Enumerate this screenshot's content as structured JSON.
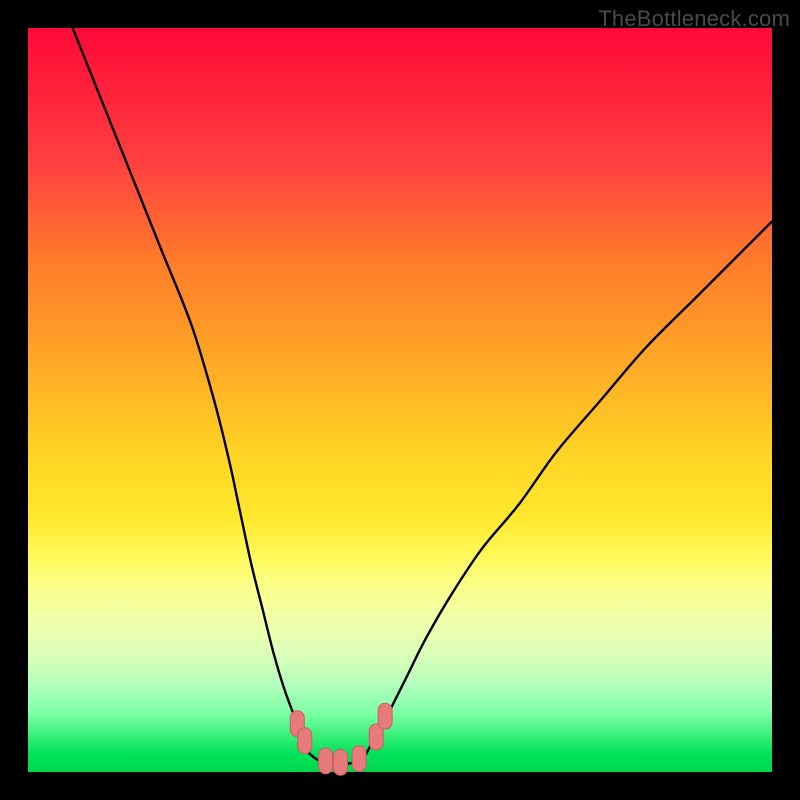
{
  "watermark": {
    "text": "TheBottleneck.com"
  },
  "colors": {
    "frame": "#000000",
    "curve": "#000000",
    "marker_fill": "#e77a7a",
    "marker_stroke": "#c76262",
    "gradient_stops": [
      "#ff0a3a",
      "#ff1a3a",
      "#ff4040",
      "#ff7a2b",
      "#ffa526",
      "#ffd324",
      "#ffe92e",
      "#fff95a",
      "#fbff88",
      "#f2ffa7",
      "#dcffb8",
      "#b6ffbd",
      "#7effa7",
      "#3bf07c",
      "#00e35a",
      "#00d84c"
    ]
  },
  "chart_data": {
    "type": "line",
    "title": "",
    "xlabel": "",
    "ylabel": "",
    "xlim": [
      0,
      100
    ],
    "ylim": [
      0,
      100
    ],
    "grid": false,
    "legend": null,
    "series": [
      {
        "name": "left-curve",
        "x": [
          6,
          10,
          14,
          18,
          22,
          25,
          27,
          28.5,
          30,
          31.5,
          33,
          34.5,
          36,
          37,
          37.8
        ],
        "values": [
          100,
          90,
          80,
          70,
          60,
          50,
          42,
          35,
          28,
          22,
          16,
          11,
          7,
          4.5,
          2.5
        ]
      },
      {
        "name": "right-curve",
        "x": [
          46,
          47.5,
          49,
          51,
          53.5,
          57,
          61,
          66,
          71,
          77,
          83,
          90,
          96,
          100
        ],
        "values": [
          3.5,
          6,
          9,
          13,
          18,
          24,
          30,
          36,
          43,
          50,
          57,
          64,
          70,
          74
        ]
      },
      {
        "name": "valley-floor",
        "x": [
          37.8,
          39,
          40.5,
          42,
          43.5,
          45,
          46
        ],
        "values": [
          2.5,
          1.6,
          1.2,
          1.1,
          1.2,
          1.8,
          3.5
        ]
      }
    ],
    "markers": {
      "name": "highlighted-points",
      "shape": "rounded-bar",
      "points": [
        {
          "x": 36.2,
          "y": 6.5
        },
        {
          "x": 37.2,
          "y": 4.2
        },
        {
          "x": 40.0,
          "y": 1.5
        },
        {
          "x": 42.0,
          "y": 1.3
        },
        {
          "x": 44.5,
          "y": 1.8
        },
        {
          "x": 46.8,
          "y": 4.7
        },
        {
          "x": 48.0,
          "y": 7.5
        }
      ]
    }
  }
}
